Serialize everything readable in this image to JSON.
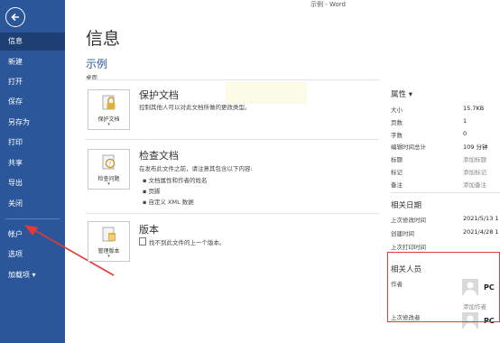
{
  "window": {
    "title": "示例 - Word"
  },
  "sidebar": {
    "items": [
      {
        "label": "信息",
        "active": true
      },
      {
        "label": "新建"
      },
      {
        "label": "打开"
      },
      {
        "label": "保存"
      },
      {
        "label": "另存为"
      },
      {
        "label": "打印"
      },
      {
        "label": "共享"
      },
      {
        "label": "导出"
      },
      {
        "label": "关闭"
      },
      {
        "label": "帐户"
      },
      {
        "label": "选项"
      },
      {
        "label": "加载项 ▾"
      }
    ]
  },
  "main": {
    "title": "信息",
    "doc_name": "示例",
    "doc_location": "桌面",
    "sections": [
      {
        "tile_label": "保护文档",
        "title": "保护文档",
        "desc": "控制其他人可以对此文档所做的更改类型。",
        "icon": "lock-icon"
      },
      {
        "tile_label": "检查问题",
        "title": "检查文档",
        "desc": "在发布此文件之前，请注意其包含以下内容:",
        "bullets": [
          "文档属性和作者的姓名",
          "页脚",
          "自定义 XML 数据"
        ],
        "icon": "inspect-icon"
      },
      {
        "tile_label": "管理版本",
        "title": "版本",
        "desc": "找不到此文件的上一个版本。",
        "icon": "versions-icon"
      }
    ]
  },
  "properties": {
    "header": "属性 ▾",
    "rows": [
      {
        "key": "大小",
        "value": "15.7KB"
      },
      {
        "key": "页数",
        "value": "1"
      },
      {
        "key": "字数",
        "value": "0"
      },
      {
        "key": "编辑时间总计",
        "value": "109 分钟"
      },
      {
        "key": "标题",
        "value": "添加标题"
      },
      {
        "key": "标记",
        "value": "添加标记"
      },
      {
        "key": "备注",
        "value": "添加备注"
      }
    ],
    "dates_header": "相关日期",
    "dates": [
      {
        "key": "上次修改时间",
        "value": "2021/5/13 1"
      },
      {
        "key": "创建时间",
        "value": "2021/4/28 1"
      },
      {
        "key": "上次打印时间",
        "value": ""
      }
    ],
    "people_header": "相关人员",
    "author_label": "作者",
    "author_name": "PC",
    "add_author": "添加作者",
    "last_modified_by_label": "上次修改者",
    "last_modified_by_name": "PC"
  },
  "colors": {
    "sidebar": "#2b579a",
    "sidebar_active": "#1e3f73",
    "annotation_red": "#e53935",
    "link_blue": "#2b579a"
  }
}
